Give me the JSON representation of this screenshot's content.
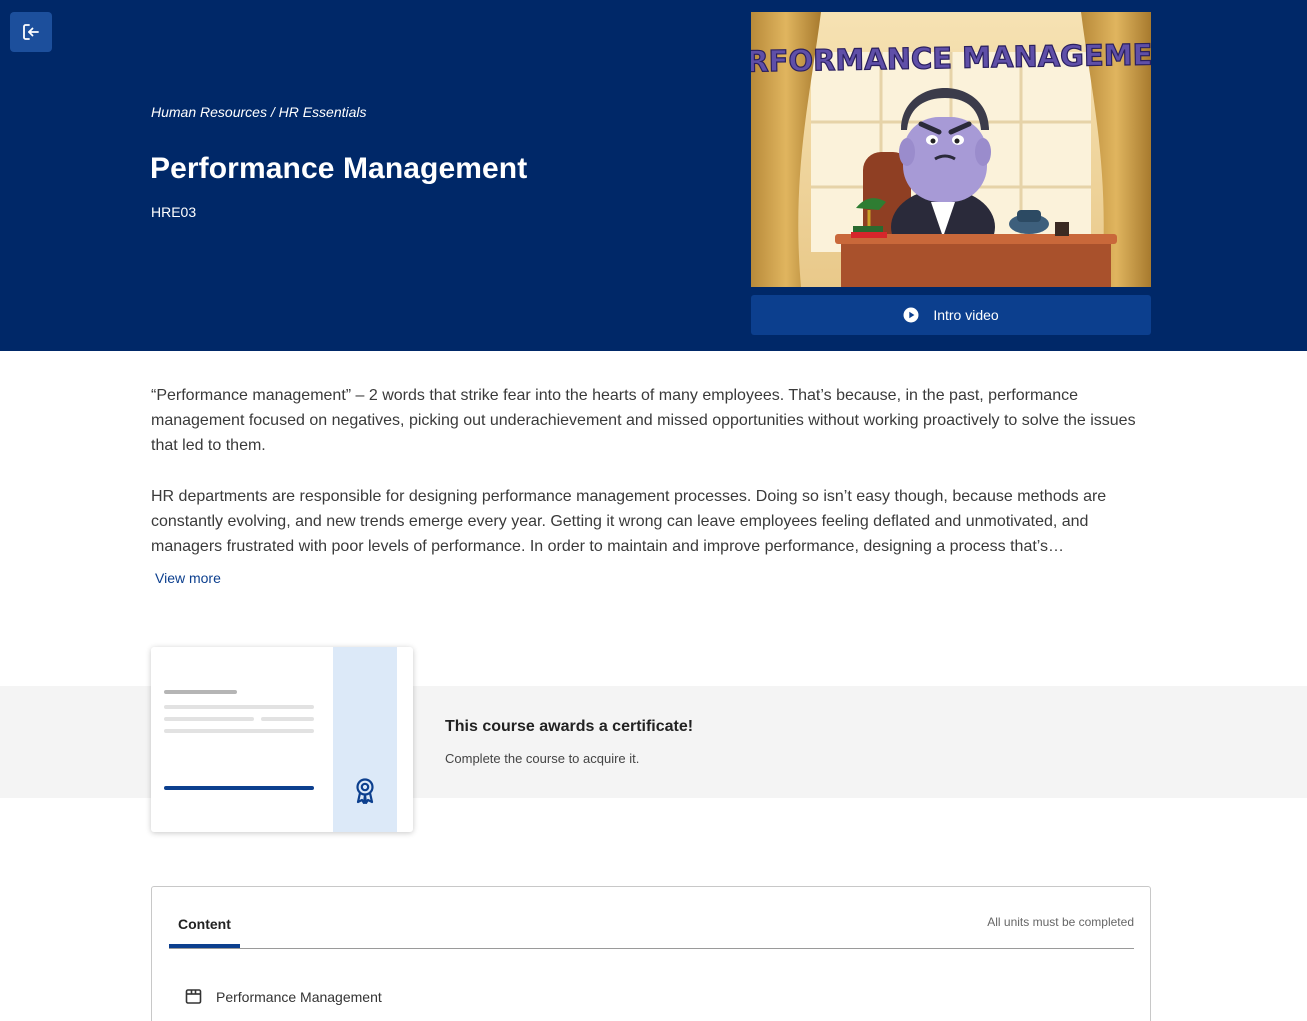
{
  "header": {
    "exit_icon": "exit-icon",
    "breadcrumb": "Human Resources / HR Essentials",
    "title": "Performance Management",
    "code": "HRE03",
    "thumbnail_banner": "PERFORMANCE MANAGEMENT",
    "intro_button_label": "Intro video",
    "intro_icon": "play-icon"
  },
  "description": {
    "paragraph_1": "“Performance management” – 2 words that strike fear into the hearts of many employees. That’s because, in the past, performance management focused on negatives, picking out underachievement and missed opportunities without working proactively to solve the issues that led to them.",
    "paragraph_2": "HR departments are responsible for designing performance management processes. Doing so isn’t easy though, because methods are constantly evolving, and new trends emerge every year. Getting it wrong can leave employees feeling deflated and unmotivated, and managers frustrated with poor levels of performance. In order to maintain and improve performance, designing a process that’s…",
    "view_more": "View more"
  },
  "certificate": {
    "title": "This course awards a certificate!",
    "subtitle": "Complete the course to acquire it.",
    "icon": "award-ribbon-icon"
  },
  "content": {
    "tab_label": "Content",
    "requirement_note": "All units must be completed",
    "units": [
      {
        "label": "Performance Management",
        "icon": "package-icon"
      }
    ]
  },
  "colors": {
    "hero_bg": "#002868",
    "accent": "#0c3f8e",
    "button_bg": "#1c4f9c",
    "band_bg": "#f4f4f4"
  }
}
